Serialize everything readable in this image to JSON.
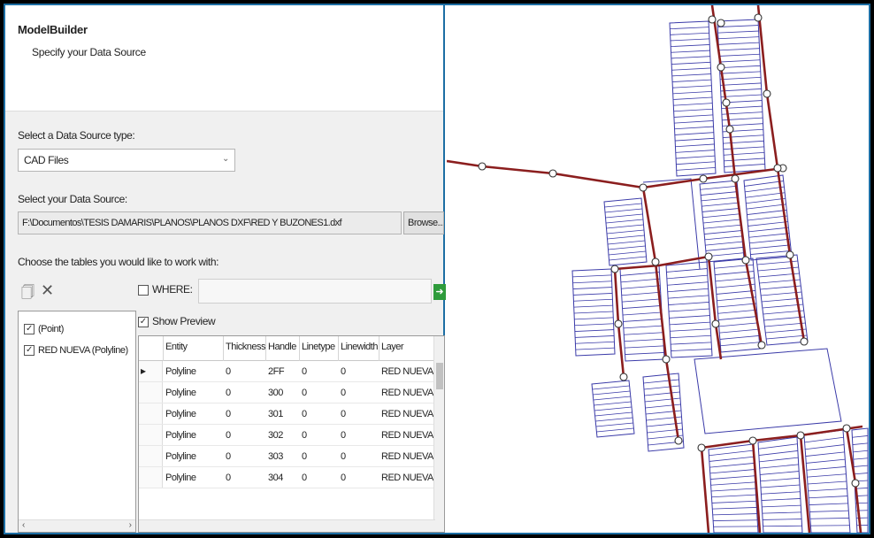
{
  "dialog": {
    "title": "ModelBuilder",
    "subtitle": "Specify your Data Source",
    "source_type_label": "Select a Data Source type:",
    "source_type_value": "CAD Files",
    "data_source_label": "Select your Data Source:",
    "data_source_path": "F:\\Documentos\\TESIS DAMARIS\\PLANOS\\PLANOS DXF\\RED Y BUZONES1.dxf",
    "browse_label": "Browse...",
    "tables_label": "Choose the tables you would like to work with:",
    "where_label": "WHERE:",
    "show_preview_label": "Show Preview",
    "tables": [
      {
        "label": "(Point)",
        "checked": true
      },
      {
        "label": "RED NUEVA (Polyline)",
        "checked": true
      }
    ],
    "grid": {
      "columns": [
        "Entity",
        "Thickness",
        "Handle",
        "Linetype",
        "Linewidth",
        "Layer"
      ],
      "rows": [
        [
          "Polyline",
          "0",
          "2FF",
          "0",
          "0",
          "RED NUEVA"
        ],
        [
          "Polyline",
          "0",
          "300",
          "0",
          "0",
          "RED NUEVA"
        ],
        [
          "Polyline",
          "0",
          "301",
          "0",
          "0",
          "RED NUEVA"
        ],
        [
          "Polyline",
          "0",
          "302",
          "0",
          "0",
          "RED NUEVA"
        ],
        [
          "Polyline",
          "0",
          "303",
          "0",
          "0",
          "RED NUEVA"
        ],
        [
          "Polyline",
          "0",
          "304",
          "0",
          "0",
          "RED NUEVA"
        ]
      ],
      "current_row": 0
    }
  },
  "colors": {
    "frame": "#1c6ea4",
    "pipe": "#8b1e1e",
    "block": "#3a3aa8"
  }
}
